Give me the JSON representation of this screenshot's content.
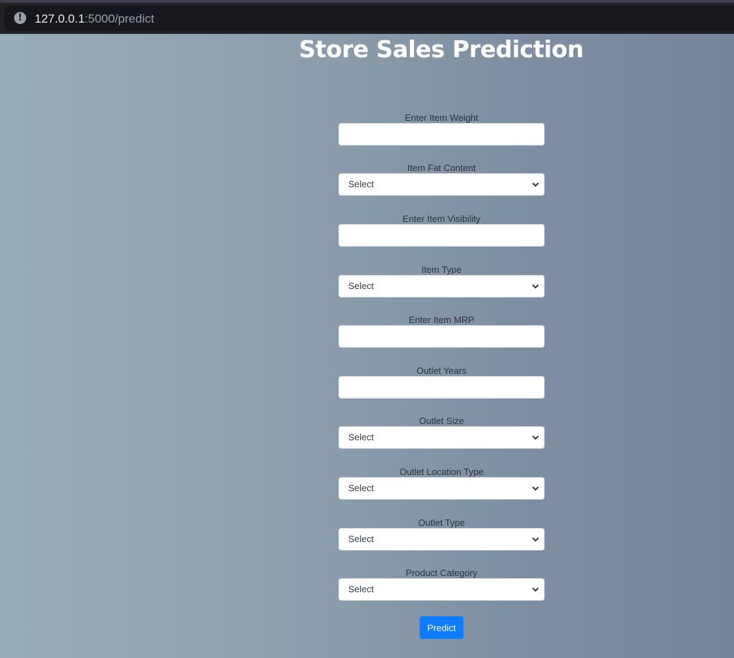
{
  "browser": {
    "url_host": "127.0.0.1",
    "url_rest": ":5000/predict"
  },
  "page": {
    "title": "Store Sales Prediction",
    "fields": [
      {
        "label": "Enter Item Weight",
        "kind": "input",
        "value": ""
      },
      {
        "label": "Item Fat Content",
        "kind": "select",
        "value": "Select"
      },
      {
        "label": "Enter Item Visibility",
        "kind": "input",
        "value": ""
      },
      {
        "label": "Item Type",
        "kind": "select",
        "value": "Select"
      },
      {
        "label": "Enter Item MRP",
        "kind": "input",
        "value": ""
      },
      {
        "label": "Outlet Years",
        "kind": "input",
        "value": ""
      },
      {
        "label": "Outlet Size",
        "kind": "select",
        "value": "Select"
      },
      {
        "label": "Outlet Location Type",
        "kind": "select",
        "value": "Select"
      },
      {
        "label": "Outlet Type",
        "kind": "select",
        "value": "Select"
      },
      {
        "label": "Product Category",
        "kind": "select",
        "value": "Select"
      }
    ],
    "submit_label": "Predict"
  },
  "colors": {
    "button": "#0d7cff",
    "background_left": "#9aaeb7",
    "background_right": "#77849c"
  },
  "icons": [
    "info-icon",
    "chevron-down-icon"
  ]
}
